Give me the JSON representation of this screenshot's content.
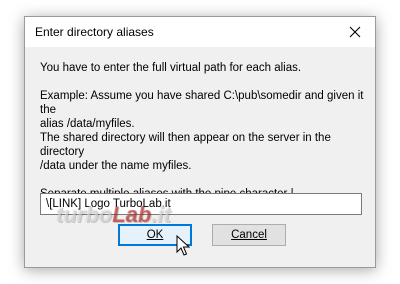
{
  "dialog": {
    "title": "Enter directory aliases",
    "lines": {
      "instruction": "You have to enter the full virtual path for each alias.",
      "example_1": "Example: Assume you have shared C:\\pub\\somedir and given it the",
      "example_2": "alias /data/myfiles.",
      "example_3": "The shared directory will then appear on the server in the directory",
      "example_4": "/data under the name myfiles.",
      "separator_hint": "Separate multiple aliases with the pipe character |"
    },
    "alias_input_value": "\\[LINK] Logo TurboLab.it",
    "ok_label": "OK",
    "cancel_label": "Cancel"
  },
  "watermark": {
    "prefix": "turbo",
    "accent": "Lab",
    "suffix": ".it"
  }
}
